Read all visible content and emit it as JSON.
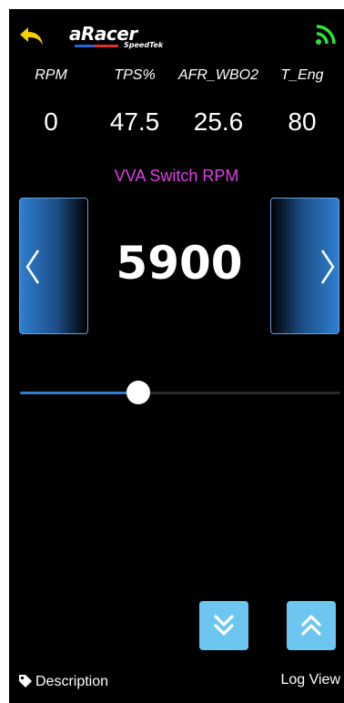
{
  "header": {
    "back_icon": "back-arrow-icon",
    "logo_main": "aRacer",
    "logo_sub": "SpeedTek",
    "signal_icon": "wifi-signal-icon",
    "colors": {
      "back": "#f5d000",
      "signal": "#2ee62e"
    }
  },
  "stats": [
    {
      "label": "RPM",
      "value": "0"
    },
    {
      "label": "TPS%",
      "value": "47.5"
    },
    {
      "label": "AFR_WBO2",
      "value": "25.6"
    },
    {
      "label": "T_Eng",
      "value": "80"
    }
  ],
  "parameter": {
    "title": "VVA Switch RPM",
    "value": "5900",
    "slider_fraction": 0.37,
    "colors": {
      "title": "#e040e8",
      "accent": "#2f7fd0"
    }
  },
  "controls": {
    "prev_icon": "chevron-left-icon",
    "next_icon": "chevron-right-icon",
    "down_icon": "double-chevron-down-icon",
    "up_icon": "double-chevron-up-icon",
    "step_color": "#6cc6f0"
  },
  "footer": {
    "description_icon": "tag-icon",
    "description_label": "Description",
    "log_view_label": "Log View"
  }
}
